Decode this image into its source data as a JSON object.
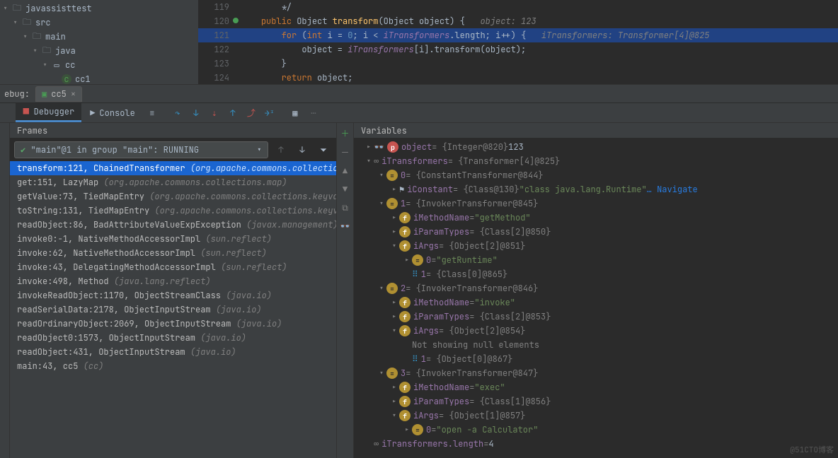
{
  "project": {
    "nodes": [
      {
        "indent": 0,
        "arrow": "▾",
        "icon": "folder",
        "label": "javassisttest"
      },
      {
        "indent": 1,
        "arrow": "▾",
        "icon": "folder-src",
        "label": "src"
      },
      {
        "indent": 2,
        "arrow": "▾",
        "icon": "folder",
        "label": "main"
      },
      {
        "indent": 3,
        "arrow": "▾",
        "icon": "folder",
        "label": "java"
      },
      {
        "indent": 4,
        "arrow": "▾",
        "icon": "package",
        "label": "cc"
      },
      {
        "indent": 5,
        "arrow": "",
        "icon": "class",
        "label": "cc1"
      }
    ]
  },
  "editor": {
    "lines": [
      {
        "n": "119",
        "html": "        */",
        "cls": ""
      },
      {
        "n": "120",
        "html": "    <span class='kw'>public</span> Object <span class='fn'>transform</span>(Object <span class='typ'>object</span>) {   <span class='cmt'>object: 123</span>",
        "cls": "ln120"
      },
      {
        "n": "121",
        "html": "        <span class='kw'>for</span> (<span class='kw'>int</span> <span class='typ'>i</span> = <span class='num'>0</span>; <span class='typ'>i</span> &lt; <span class='field'>iTransformers</span>.length; <span class='typ'>i</span>++) {   <span class='cmt'>iTransformers: Transformer[4]@825</span>",
        "cls": "ln121"
      },
      {
        "n": "122",
        "html": "            <span class='typ'>object</span> = <span class='field'>iTransformers</span>[<span class='typ'>i</span>].transform(<span class='typ'>object</span>);",
        "cls": ""
      },
      {
        "n": "123",
        "html": "        }",
        "cls": ""
      },
      {
        "n": "124",
        "html": "        <span class='kw'>return</span> <span class='typ'>object</span>;",
        "cls": ""
      }
    ]
  },
  "debug_label": "ebug:",
  "debug_tab": "cc5",
  "tool_tabs": {
    "debugger": "Debugger",
    "console": "Console"
  },
  "frames_header": "Frames",
  "variables_header": "Variables",
  "thread_select": "\"main\"@1 in group \"main\": RUNNING",
  "frames": [
    {
      "m": "transform:121, ChainedTransformer ",
      "p": "(org.apache.commons.collections.f",
      "sel": true
    },
    {
      "m": "get:151, LazyMap ",
      "p": "(org.apache.commons.collections.map)"
    },
    {
      "m": "getValue:73, TiedMapEntry ",
      "p": "(org.apache.commons.collections.keyvalue"
    },
    {
      "m": "toString:131, TiedMapEntry ",
      "p": "(org.apache.commons.collections.keyvalue"
    },
    {
      "m": "readObject:86, BadAttributeValueExpException ",
      "p": "(javax.management)"
    },
    {
      "m": "invoke0:-1, NativeMethodAccessorImpl ",
      "p": "(sun.reflect)"
    },
    {
      "m": "invoke:62, NativeMethodAccessorImpl ",
      "p": "(sun.reflect)"
    },
    {
      "m": "invoke:43, DelegatingMethodAccessorImpl ",
      "p": "(sun.reflect)"
    },
    {
      "m": "invoke:498, Method ",
      "p": "(java.lang.reflect)"
    },
    {
      "m": "invokeReadObject:1170, ObjectStreamClass ",
      "p": "(java.io)"
    },
    {
      "m": "readSerialData:2178, ObjectInputStream ",
      "p": "(java.io)"
    },
    {
      "m": "readOrdinaryObject:2069, ObjectInputStream ",
      "p": "(java.io)"
    },
    {
      "m": "readObject0:1573, ObjectInputStream ",
      "p": "(java.io)"
    },
    {
      "m": "readObject:431, ObjectInputStream ",
      "p": "(java.io)"
    },
    {
      "m": "main:43, cc5 ",
      "p": "(cc)"
    }
  ],
  "vars": [
    {
      "d": 0,
      "exp": "▸",
      "icon": "vp",
      "name": "object",
      "rest": " = {Integer@820} ",
      "extra": "123",
      "ek": "vnum",
      "glasses": true
    },
    {
      "d": 0,
      "exp": "▾",
      "icon": "",
      "name": "iTransformers",
      "rest": " = {Transformer[4]@825}",
      "glasses": true,
      "inf": true
    },
    {
      "d": 1,
      "exp": "▾",
      "icon": "ve",
      "name": "0",
      "rest": " = {ConstantTransformer@844}"
    },
    {
      "d": 2,
      "exp": "▸",
      "icon": "",
      "name": "iConstant",
      "rest": " = {Class@130} ",
      "extra": "\"class java.lang.Runtime\"",
      "ek": "vstr",
      "nav": " … Navigate",
      "flag": true
    },
    {
      "d": 1,
      "exp": "▾",
      "icon": "ve",
      "name": "1",
      "rest": " = {InvokerTransformer@845}"
    },
    {
      "d": 2,
      "exp": "▸",
      "icon": "vf",
      "name": "iMethodName",
      "rest": " = ",
      "extra": "\"getMethod\"",
      "ek": "vstr"
    },
    {
      "d": 2,
      "exp": "▸",
      "icon": "vf",
      "name": "iParamTypes",
      "rest": " = {Class[2]@850}"
    },
    {
      "d": 2,
      "exp": "▾",
      "icon": "vf",
      "name": "iArgs",
      "rest": " = {Object[2]@851}"
    },
    {
      "d": 3,
      "exp": "▸",
      "icon": "ve",
      "name": "0",
      "rest": " = ",
      "extra": "\"getRuntime\"",
      "ek": "vstr"
    },
    {
      "d": 3,
      "exp": "",
      "icon": "",
      "name": "1",
      "rest": " = {Class[0]@865}",
      "arr": true
    },
    {
      "d": 1,
      "exp": "▾",
      "icon": "ve",
      "name": "2",
      "rest": " = {InvokerTransformer@846}"
    },
    {
      "d": 2,
      "exp": "▸",
      "icon": "vf",
      "name": "iMethodName",
      "rest": " = ",
      "extra": "\"invoke\"",
      "ek": "vstr"
    },
    {
      "d": 2,
      "exp": "▸",
      "icon": "vf",
      "name": "iParamTypes",
      "rest": " = {Class[2]@853}"
    },
    {
      "d": 2,
      "exp": "▾",
      "icon": "vf",
      "name": "iArgs",
      "rest": " = {Object[2]@854}"
    },
    {
      "d": 3,
      "exp": "",
      "icon": "",
      "name": "",
      "rest": "Not showing null elements",
      "plain": true
    },
    {
      "d": 3,
      "exp": "",
      "icon": "",
      "name": "1",
      "rest": " = {Object[0]@867}",
      "arr": true
    },
    {
      "d": 1,
      "exp": "▾",
      "icon": "ve",
      "name": "3",
      "rest": " = {InvokerTransformer@847}"
    },
    {
      "d": 2,
      "exp": "▸",
      "icon": "vf",
      "name": "iMethodName",
      "rest": " = ",
      "extra": "\"exec\"",
      "ek": "vstr"
    },
    {
      "d": 2,
      "exp": "▸",
      "icon": "vf",
      "name": "iParamTypes",
      "rest": " = {Class[1]@856}"
    },
    {
      "d": 2,
      "exp": "▾",
      "icon": "vf",
      "name": "iArgs",
      "rest": " = {Object[1]@857}"
    },
    {
      "d": 3,
      "exp": "▸",
      "icon": "ve",
      "name": "0",
      "rest": " = ",
      "extra": "\"open -a Calculator\"",
      "ek": "vstr"
    },
    {
      "d": 0,
      "exp": "",
      "icon": "",
      "name": "iTransformers.length",
      "rest": " = ",
      "extra": "4",
      "ek": "vnum",
      "glasses": true,
      "inf": true
    }
  ],
  "watermark": "@51CTO博客"
}
